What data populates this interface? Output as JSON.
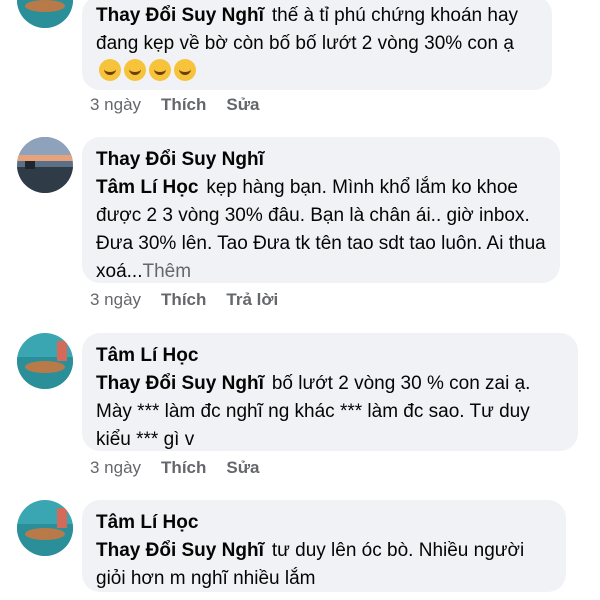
{
  "comments": [
    {
      "author": "Thay Đổi  Suy Nghĩ",
      "mention": "",
      "text": "thế à tỉ phú chứng khoán hay đang kẹp về bờ còn bố bố lướt 2 vòng 30% con ạ",
      "emoji_count": 4,
      "time": "3 ngày",
      "like_label": "Thích",
      "second_action": "Sửa"
    },
    {
      "author": "Thay Đổi  Suy Nghĩ",
      "mention": "Tâm Lí Học",
      "text": "kẹp hàng bạn. Mình khổ lắm ko khoe được  2 3 vòng  30% đâu.  Bạn là chân ái.. giờ inbox. Đưa 30% lên.  Tao Đưa tk tên tao sdt tao luôn.   Ai thua xoá...",
      "more_label": "Thêm",
      "time": "3 ngày",
      "like_label": "Thích",
      "second_action": "Trả lời"
    },
    {
      "author": "Tâm Lí Học",
      "mention": "Thay Đổi  Suy Nghĩ",
      "text": "bố lướt 2 vòng 30 % con zai ạ. Mày *** làm đc nghĩ ng khác *** làm đc sao. Tư duy kiểu *** gì v",
      "time": "3 ngày",
      "like_label": "Thích",
      "second_action": "Sửa"
    },
    {
      "author": "Tâm Lí Học",
      "mention": "Thay Đổi  Suy Nghĩ",
      "text": "tư duy lên óc bò. Nhiều người giỏi hơn m nghĩ nhiều lắm"
    }
  ],
  "icons": {
    "emoji": "rolling-on-floor-laughing-icon",
    "avatar_a": "teal-landscape-avatar",
    "avatar_b": "sunset-road-avatar"
  }
}
